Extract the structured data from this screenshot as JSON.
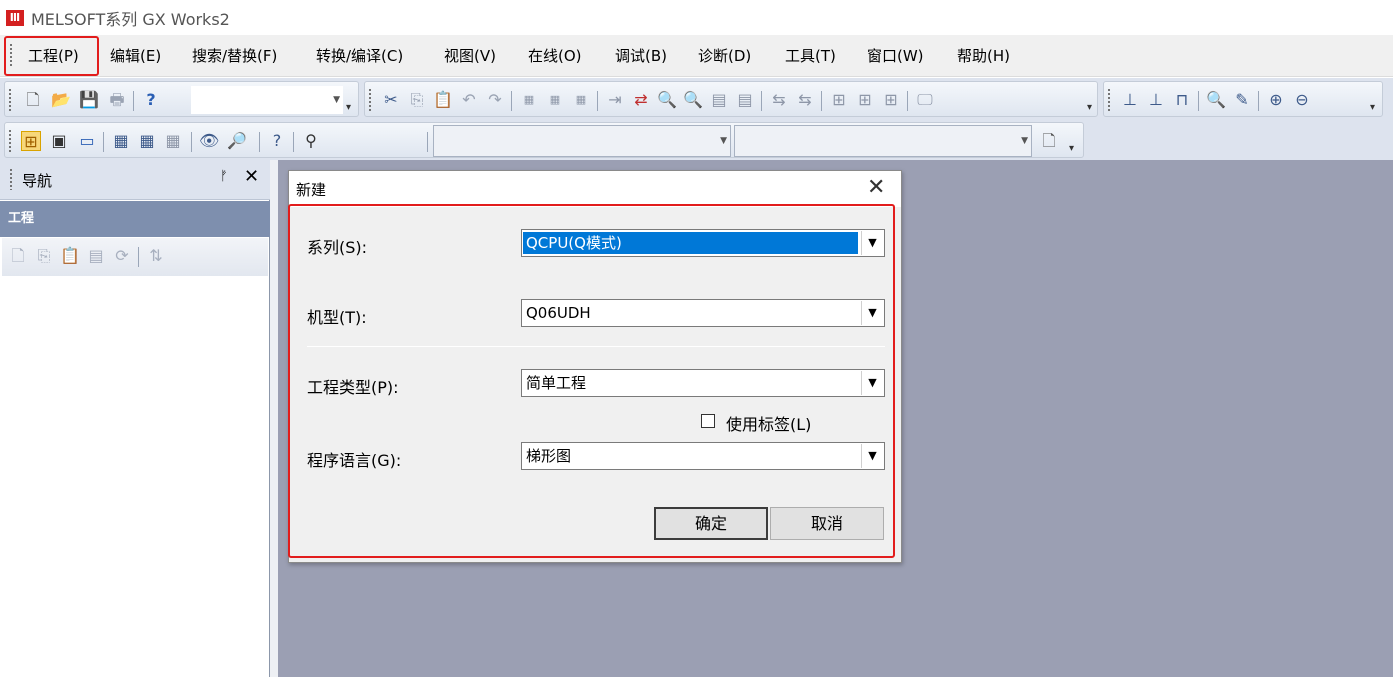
{
  "app": {
    "title": "MELSOFT系列 GX Works2",
    "logo_text": "Ⅲ"
  },
  "menu": [
    {
      "label": "工程(P)"
    },
    {
      "label": "编辑(E)"
    },
    {
      "label": "搜索/替换(F)"
    },
    {
      "label": "转换/编译(C)"
    },
    {
      "label": "视图(V)"
    },
    {
      "label": "在线(O)"
    },
    {
      "label": "调试(B)"
    },
    {
      "label": "诊断(D)"
    },
    {
      "label": "工具(T)"
    },
    {
      "label": "窗口(W)"
    },
    {
      "label": "帮助(H)"
    }
  ],
  "navigation": {
    "title": "导航",
    "pin": "ᚠ",
    "close": "✕",
    "section": "工程"
  },
  "dialog": {
    "title": "新建",
    "close": "✕",
    "series_label": "系列(S):",
    "series_value": "QCPU(Q模式)",
    "model_label": "机型(T):",
    "model_value": "Q06UDH",
    "project_type_label": "工程类型(P):",
    "project_type_value": "简单工程",
    "use_label_text": "使用标签(L)",
    "use_label_checked": false,
    "language_label": "程序语言(G):",
    "language_value": "梯形图",
    "ok": "确定",
    "cancel": "取消"
  },
  "colors": {
    "highlight": "#e21c1c",
    "workspace": "#9b9fb3",
    "nav_section": "#7e8fae",
    "selection": "#0078d7"
  }
}
